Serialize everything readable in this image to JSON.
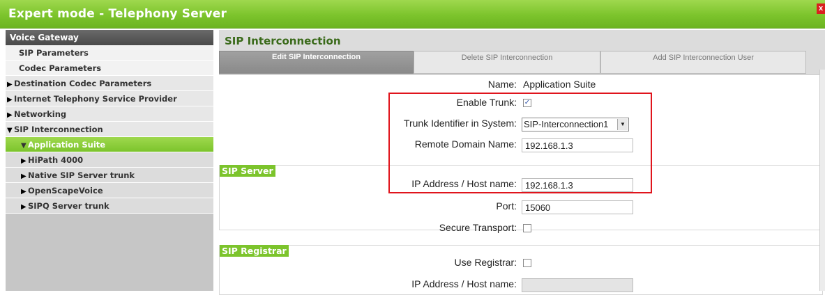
{
  "window": {
    "title": "Expert mode - Telephony Server",
    "close_glyph": "x"
  },
  "sidebar": {
    "header": "Voice Gateway",
    "items": [
      {
        "label": "SIP Parameters",
        "level": 1,
        "arrow": ""
      },
      {
        "label": "Codec Parameters",
        "level": 1,
        "arrow": ""
      },
      {
        "label": "Destination Codec Parameters",
        "level": 0,
        "arrow": "▶"
      },
      {
        "label": "Internet Telephony Service Provider",
        "level": 0,
        "arrow": "▶"
      },
      {
        "label": "Networking",
        "level": 0,
        "arrow": "▶"
      },
      {
        "label": "SIP Interconnection",
        "level": 0,
        "arrow": "▼"
      },
      {
        "label": "Application Suite",
        "level": 2,
        "arrow": "▼",
        "active": true
      },
      {
        "label": "HiPath 4000",
        "level": 2,
        "arrow": "▶"
      },
      {
        "label": "Native SIP Server trunk",
        "level": 2,
        "arrow": "▶"
      },
      {
        "label": "OpenScapeVoice",
        "level": 2,
        "arrow": "▶"
      },
      {
        "label": "SIPQ Server trunk",
        "level": 2,
        "arrow": "▶"
      }
    ]
  },
  "main": {
    "title": "SIP Interconnection",
    "tabs": [
      {
        "label": "Edit SIP Interconnection",
        "active": true
      },
      {
        "label": "Delete SIP Interconnection",
        "active": false
      },
      {
        "label": "Add SIP Interconnection User",
        "active": false
      }
    ],
    "fields": {
      "name_label": "Name:",
      "name_value": "Application Suite",
      "enable_trunk_label": "Enable Trunk:",
      "enable_trunk_checked": true,
      "trunk_id_label": "Trunk Identifier in System:",
      "trunk_id_value": "SIP-Interconnection1",
      "remote_domain_label": "Remote Domain Name:",
      "remote_domain_value": "192.168.1.3"
    },
    "sip_server": {
      "title": "SIP Server",
      "ip_label": "IP Address / Host name:",
      "ip_value": "192.168.1.3",
      "port_label": "Port:",
      "port_value": "15060",
      "secure_label": "Secure Transport:",
      "secure_checked": false
    },
    "sip_registrar": {
      "title": "SIP Registrar",
      "use_label": "Use Registrar:",
      "use_checked": false,
      "ip_label": "IP Address / Host name:",
      "ip_value": ""
    }
  },
  "colors": {
    "accent_green": "#7cc42c",
    "highlight_red": "#e0141c"
  }
}
